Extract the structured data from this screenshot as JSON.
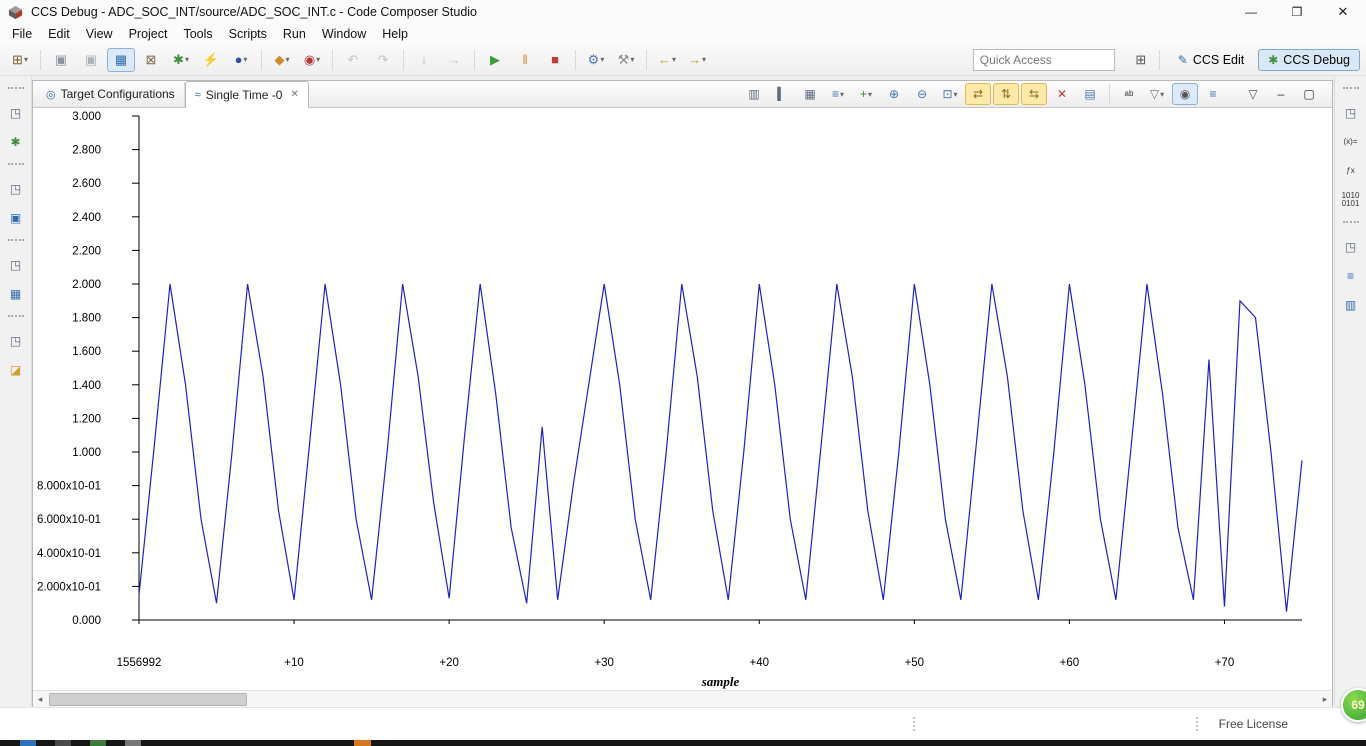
{
  "window": {
    "title": "CCS Debug - ADC_SOC_INT/source/ADC_SOC_INT.c - Code Composer Studio",
    "minimize_glyph": "—",
    "maximize_glyph": "❐",
    "close_glyph": "✕"
  },
  "menu": {
    "items": [
      "File",
      "Edit",
      "View",
      "Project",
      "Tools",
      "Scripts",
      "Run",
      "Window",
      "Help"
    ]
  },
  "ui": {
    "dropdown_glyph": "▾"
  },
  "toolbar": {
    "quick_access_placeholder": "Quick Access",
    "items": [
      {
        "name": "new-wizard",
        "glyph": "⊞",
        "color": "#7a5c2e",
        "drop": true
      },
      {
        "sep": true
      },
      {
        "name": "save",
        "glyph": "▣",
        "color": "#8b95a1"
      },
      {
        "name": "save-all",
        "glyph": "▣",
        "color": "#aab2bb"
      },
      {
        "name": "new-target-configuration",
        "glyph": "▦",
        "color": "#2f6bad",
        "pressed": true
      },
      {
        "name": "build",
        "glyph": "⊠",
        "color": "#7d6a4a"
      },
      {
        "name": "debug",
        "glyph": "✱",
        "color": "#3f8f3f",
        "drop": true
      },
      {
        "name": "flash",
        "glyph": "⚡",
        "color": "#c9a227"
      },
      {
        "name": "breakpoint",
        "glyph": "●",
        "color": "#2e4e9e",
        "drop": true
      },
      {
        "sep": true
      },
      {
        "name": "paint",
        "glyph": "◆",
        "color": "#cf8a2d",
        "drop": true
      },
      {
        "name": "connect",
        "glyph": "◉",
        "color": "#b23a3a",
        "drop": true
      },
      {
        "sep": true
      },
      {
        "name": "restart",
        "glyph": "↶",
        "color": "#777777",
        "disabled": true
      },
      {
        "name": "step-return",
        "glyph": "↷",
        "color": "#777777",
        "disabled": true
      },
      {
        "sep": true
      },
      {
        "name": "step-into",
        "glyph": "↓",
        "color": "#777777",
        "disabled": true
      },
      {
        "name": "step-over",
        "glyph": "→",
        "color": "#777777",
        "disabled": true
      },
      {
        "sep": true
      },
      {
        "name": "resume",
        "glyph": "▶",
        "color": "#3f9b3f"
      },
      {
        "name": "suspend",
        "glyph": "‖",
        "color": "#d98a2b"
      },
      {
        "name": "terminate",
        "glyph": "■",
        "color": "#c23b3b"
      },
      {
        "sep": true
      },
      {
        "name": "advanced-settings",
        "glyph": "⚙",
        "color": "#4a7ab5",
        "drop": true
      },
      {
        "name": "tools",
        "glyph": "⚒",
        "color": "#8a8f96",
        "drop": true
      },
      {
        "sep": true
      },
      {
        "name": "back",
        "glyph": "←",
        "color": "#c09a2e",
        "drop": true
      },
      {
        "name": "forward",
        "glyph": "→",
        "color": "#c09a2e",
        "drop": true
      }
    ],
    "perspectives": {
      "open_icon": "⊞",
      "edit_icon": "✎",
      "edit_label": "CCS Edit",
      "debug_icon": "✱",
      "debug_label": "CCS Debug"
    }
  },
  "left_strip": [
    {
      "grip": true
    },
    {
      "name": "restore-debug-pane",
      "glyph": "◳",
      "color": "#5a6b7d"
    },
    {
      "name": "debug-view",
      "glyph": "✱",
      "color": "#3f8f3f"
    },
    {
      "grip": true
    },
    {
      "name": "restore-console-pane",
      "glyph": "◳",
      "color": "#5a6b7d"
    },
    {
      "name": "console-view",
      "glyph": "▣",
      "color": "#2f6bad"
    },
    {
      "grip": true
    },
    {
      "name": "restore-table-pane",
      "glyph": "◳",
      "color": "#5a6b7d"
    },
    {
      "name": "table-view",
      "glyph": "▦",
      "color": "#2f6bad"
    },
    {
      "grip": true
    },
    {
      "name": "restore-project-pane",
      "glyph": "◳",
      "color": "#5a6b7d"
    },
    {
      "name": "project-explorer-view",
      "glyph": "◪",
      "color": "#c9a227"
    }
  ],
  "right_strip": [
    {
      "grip": true
    },
    {
      "name": "restore-variables-pane",
      "glyph": "◳",
      "color": "#5a6b7d"
    },
    {
      "name": "variables-view",
      "glyph": "(x)=",
      "color": "#333333",
      "text": true
    },
    {
      "name": "expressions-view",
      "glyph": "ƒx",
      "color": "#333333",
      "text": true
    },
    {
      "name": "registers-view",
      "glyph": "1010\n0101",
      "color": "#333333",
      "text": true
    },
    {
      "grip": true
    },
    {
      "name": "restore-memory-pane",
      "glyph": "◳",
      "color": "#5a6b7d"
    },
    {
      "name": "disassembly-view",
      "glyph": "≡",
      "color": "#2f6bad"
    },
    {
      "name": "memory-view",
      "glyph": "▥",
      "color": "#2f6bad"
    }
  ],
  "view": {
    "tabs": [
      {
        "label": "Target Configurations",
        "icon": "◎",
        "active": false
      },
      {
        "label": "Single Time -0",
        "icon": "≈",
        "active": true,
        "close_glyph": "✕"
      }
    ],
    "graph_toolbar": [
      {
        "name": "dual-display",
        "glyph": "▥",
        "color": "#5a6b7d"
      },
      {
        "name": "vertical-markers",
        "glyph": "▍",
        "color": "#5a6b7d"
      },
      {
        "name": "grid-display",
        "glyph": "▦",
        "color": "#5a6b7d"
      },
      {
        "name": "sort",
        "glyph": "≡",
        "color": "#3f74b5",
        "drop": true
      },
      {
        "name": "add-graph",
        "glyph": "+",
        "color": "#2f8f2f",
        "drop": true
      },
      {
        "name": "zoom-in",
        "glyph": "⊕",
        "color": "#3f74b5"
      },
      {
        "name": "zoom-out",
        "glyph": "⊖",
        "color": "#3f74b5"
      },
      {
        "name": "zoom-region",
        "glyph": "⊡",
        "color": "#3f74b5",
        "drop": true
      },
      {
        "name": "scroll-horizontal",
        "glyph": "⇄",
        "color": "#8a6d1f",
        "hl": true
      },
      {
        "name": "scroll-vertical",
        "glyph": "⇅",
        "color": "#8a6d1f",
        "hl": true
      },
      {
        "name": "auto-scale",
        "glyph": "⇆",
        "color": "#8a6d1f",
        "hl": true
      },
      {
        "name": "reset-graph",
        "glyph": "✕",
        "color": "#c23b3b"
      },
      {
        "name": "export-data",
        "glyph": "▤",
        "color": "#4a7ab5"
      },
      {
        "sep": true
      },
      {
        "name": "properties",
        "glyph": "ab",
        "color": "#333333",
        "text": true
      },
      {
        "name": "filter",
        "glyph": "▽",
        "color": "#777777",
        "drop": true
      },
      {
        "name": "capture",
        "glyph": "◉",
        "color": "#555555",
        "pressed": true
      },
      {
        "name": "legend",
        "glyph": "≡",
        "color": "#3f74b5"
      }
    ],
    "view_buttons": [
      {
        "name": "view-menu",
        "glyph": "▽",
        "color": "#555555"
      },
      {
        "name": "minimize-view",
        "glyph": "–",
        "color": "#333333"
      },
      {
        "name": "maximize-view",
        "glyph": "▢",
        "color": "#333333"
      }
    ],
    "scrollbar": {
      "left_glyph": "◂",
      "right_glyph": "▸"
    }
  },
  "chart_data": {
    "type": "line",
    "title": "Single Time -0",
    "xlabel": "sample",
    "ylabel": "",
    "line_color": "#2020c8",
    "grid": false,
    "legend": false,
    "ylim": [
      0.0,
      3.0
    ],
    "x_start_value": 1556992,
    "x_samples": 76,
    "y_ticks": [
      {
        "v": 3.0,
        "label": "3.000"
      },
      {
        "v": 2.8,
        "label": "2.800"
      },
      {
        "v": 2.6,
        "label": "2.600"
      },
      {
        "v": 2.4,
        "label": "2.400"
      },
      {
        "v": 2.2,
        "label": "2.200"
      },
      {
        "v": 2.0,
        "label": "2.000"
      },
      {
        "v": 1.8,
        "label": "1.800"
      },
      {
        "v": 1.6,
        "label": "1.600"
      },
      {
        "v": 1.4,
        "label": "1.400"
      },
      {
        "v": 1.2,
        "label": "1.200"
      },
      {
        "v": 1.0,
        "label": "1.000"
      },
      {
        "v": 0.8,
        "label": "8.000x10-01"
      },
      {
        "v": 0.6,
        "label": "6.000x10-01"
      },
      {
        "v": 0.4,
        "label": "4.000x10-01"
      },
      {
        "v": 0.2,
        "label": "2.000x10-01"
      },
      {
        "v": 0.0,
        "label": "0.000"
      }
    ],
    "x_ticks": [
      {
        "offset": 0,
        "label": "1556992"
      },
      {
        "offset": 10,
        "label": "+10"
      },
      {
        "offset": 20,
        "label": "+20"
      },
      {
        "offset": 30,
        "label": "+30"
      },
      {
        "offset": 40,
        "label": "+40"
      },
      {
        "offset": 50,
        "label": "+50"
      },
      {
        "offset": 60,
        "label": "+60"
      },
      {
        "offset": 70,
        "label": "+70"
      }
    ],
    "values": [
      0.15,
      1.05,
      2.0,
      1.4,
      0.6,
      0.1,
      1.0,
      2.0,
      1.45,
      0.65,
      0.12,
      1.05,
      2.0,
      1.4,
      0.6,
      0.12,
      1.0,
      2.0,
      1.45,
      0.7,
      0.13,
      1.1,
      2.0,
      1.35,
      0.55,
      0.1,
      1.15,
      0.12,
      0.8,
      1.4,
      2.0,
      1.4,
      0.6,
      0.12,
      1.0,
      2.0,
      1.45,
      0.65,
      0.12,
      1.0,
      2.0,
      1.4,
      0.6,
      0.12,
      1.05,
      2.0,
      1.45,
      0.65,
      0.12,
      1.0,
      2.0,
      1.4,
      0.6,
      0.12,
      1.05,
      2.0,
      1.45,
      0.65,
      0.12,
      1.0,
      2.0,
      1.4,
      0.6,
      0.12,
      1.05,
      2.0,
      1.35,
      0.55,
      0.12,
      1.55,
      0.08,
      1.9,
      1.8,
      1.0,
      0.05,
      0.95
    ]
  },
  "statusbar": {
    "license": "Free License"
  },
  "overlay": {
    "badge_text": "69"
  }
}
